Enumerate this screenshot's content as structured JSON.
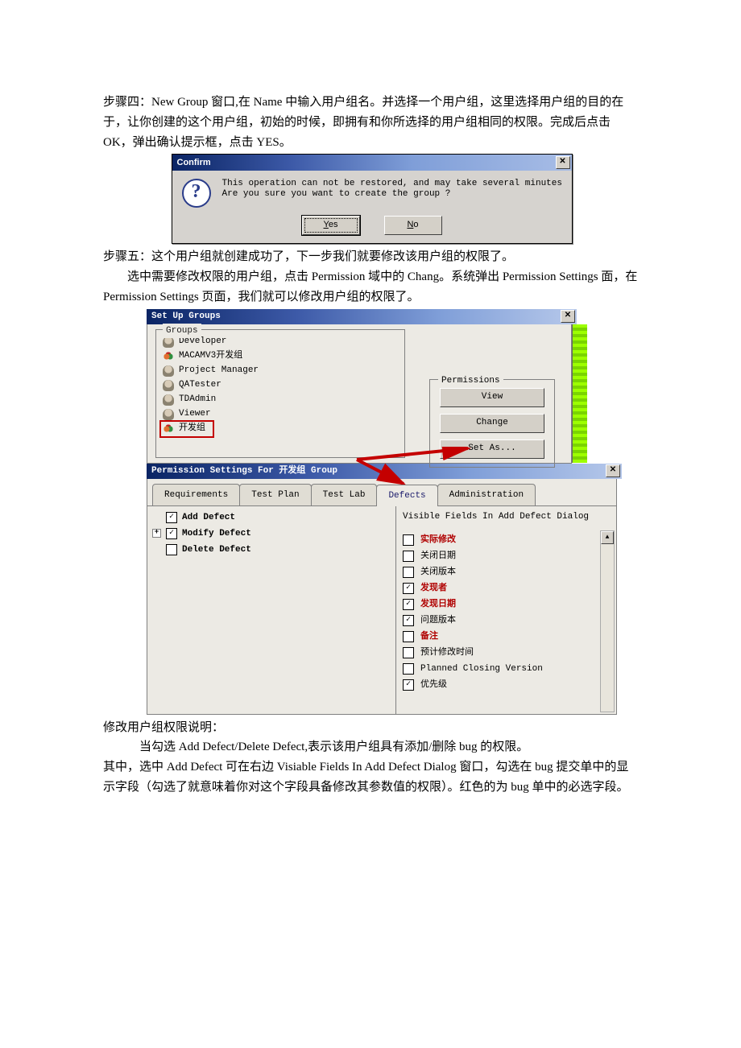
{
  "para1": "步骤四：New Group 窗口,在 Name 中输入用户组名。并选择一个用户组，这里选择用户组的目的在于，让你创建的这个用户组，初始的时候，即拥有和你所选择的用户组相同的权限。完成后点击 OK，弹出确认提示框，点击 YES。",
  "confirm": {
    "title": "Confirm",
    "text": "This operation can not be restored, and may take several minutes\nAre you sure you want to create the group ?",
    "yes_u": "Y",
    "yes_rest": "es",
    "no_u": "N",
    "no_rest": "o"
  },
  "para2a": "步骤五：这个用户组就创建成功了，下一步我们就要修改该用户组的权限了。",
  "para2b": "选中需要修改权限的用户组，点击 Permission 域中的 Chang。系统弹出 Permission Settings 面，在 Permission Settings 页面，我们就可以修改用户组的权限了。",
  "setup": {
    "title": "Set Up Groups",
    "groups_legend": "Groups",
    "items": [
      "Developer",
      "MACAMV3开发组",
      "Project Manager",
      "QATester",
      "TDAdmin",
      "Viewer",
      "开发组"
    ],
    "perm_legend": "Permissions",
    "btn_view": "View",
    "btn_change": "Change",
    "btn_setas": "Set As..."
  },
  "permwin": {
    "title": "Permission Settings For 开发组 Group",
    "tabs": [
      "Requirements",
      "Test Plan",
      "Test Lab",
      "Defects",
      "Administration"
    ],
    "defect_ops": [
      {
        "label": "Add Defect",
        "checked": true,
        "expander": false
      },
      {
        "label": "Modify Defect",
        "checked": true,
        "expander": true
      },
      {
        "label": "Delete Defect",
        "checked": false,
        "expander": false
      }
    ],
    "fields_title": "Visible Fields In Add Defect Dialog",
    "fields": [
      {
        "label": "实际修改",
        "checked": false,
        "red": true
      },
      {
        "label": "关闭日期",
        "checked": false,
        "red": false
      },
      {
        "label": "关闭版本",
        "checked": false,
        "red": false
      },
      {
        "label": "发现者",
        "checked": true,
        "red": true
      },
      {
        "label": "发现日期",
        "checked": true,
        "red": true
      },
      {
        "label": "问题版本",
        "checked": true,
        "red": false
      },
      {
        "label": "备注",
        "checked": false,
        "red": true
      },
      {
        "label": "预计修改时间",
        "checked": false,
        "red": false
      },
      {
        "label": "Planned Closing Version",
        "checked": false,
        "red": false
      },
      {
        "label": "优先级",
        "checked": true,
        "red": false
      }
    ]
  },
  "para3a": "修改用户组权限说明：",
  "para3b": "当勾选 Add Defect/Delete Defect,表示该用户组具有添加/删除 bug 的权限。",
  "para3c": "其中，选中 Add Defect 可在右边 Visiable Fields In Add Defect Dialog 窗口，勾选在 bug 提交单中的显示字段（勾选了就意味着你对这个字段具备修改其参数值的权限）。红色的为 bug 单中的必选字段。"
}
